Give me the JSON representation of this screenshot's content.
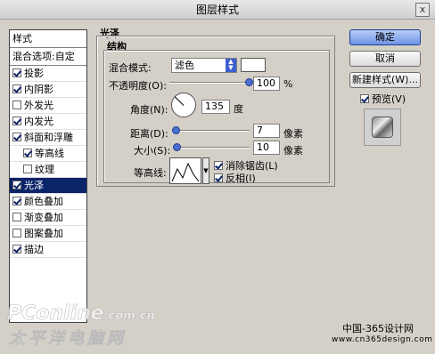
{
  "window": {
    "title": "图层样式",
    "close_label": "x"
  },
  "style_list": [
    {
      "label": "样式",
      "kind": "header"
    },
    {
      "label": "混合选项:自定",
      "kind": "header"
    },
    {
      "label": "投影",
      "checked": true
    },
    {
      "label": "内阴影",
      "checked": true
    },
    {
      "label": "外发光",
      "checked": false
    },
    {
      "label": "内发光",
      "checked": true
    },
    {
      "label": "斜面和浮雕",
      "checked": true
    },
    {
      "label": "等高线",
      "checked": true,
      "sub": true
    },
    {
      "label": "纹理",
      "checked": false,
      "sub": true
    },
    {
      "label": "光泽",
      "checked": true,
      "selected": true
    },
    {
      "label": "颜色叠加",
      "checked": true
    },
    {
      "label": "渐变叠加",
      "checked": false
    },
    {
      "label": "图案叠加",
      "checked": false
    },
    {
      "label": "描边",
      "checked": true
    }
  ],
  "satin": {
    "group_title": "光泽",
    "structure_title": "结构",
    "blend_mode_label": "混合模式:",
    "blend_mode_value": "滤色",
    "blend_color": "#ffffff",
    "opacity_label": "不透明度(O):",
    "opacity_value": "100",
    "opacity_unit": "%",
    "angle_label": "角度(N):",
    "angle_value": "135",
    "angle_unit": "度",
    "distance_label": "距离(D):",
    "distance_value": "7",
    "distance_unit": "像素",
    "size_label": "大小(S):",
    "size_value": "10",
    "size_unit": "像素",
    "contour_label": "等高线:",
    "antialias_label": "消除锯齿(L)",
    "antialias_checked": true,
    "invert_label": "反相(I)",
    "invert_checked": true
  },
  "buttons": {
    "ok": "确定",
    "cancel": "取消",
    "new_style": "新建样式(W)...",
    "preview_label": "预览(V)",
    "preview_checked": true
  },
  "watermark": {
    "brand": "PConline",
    "brand_suffix": ".com.cn",
    "brand_cn": "太平洋电脑网",
    "site_cn": "中国-365设计网",
    "site_url": "www.cn365design.com"
  }
}
